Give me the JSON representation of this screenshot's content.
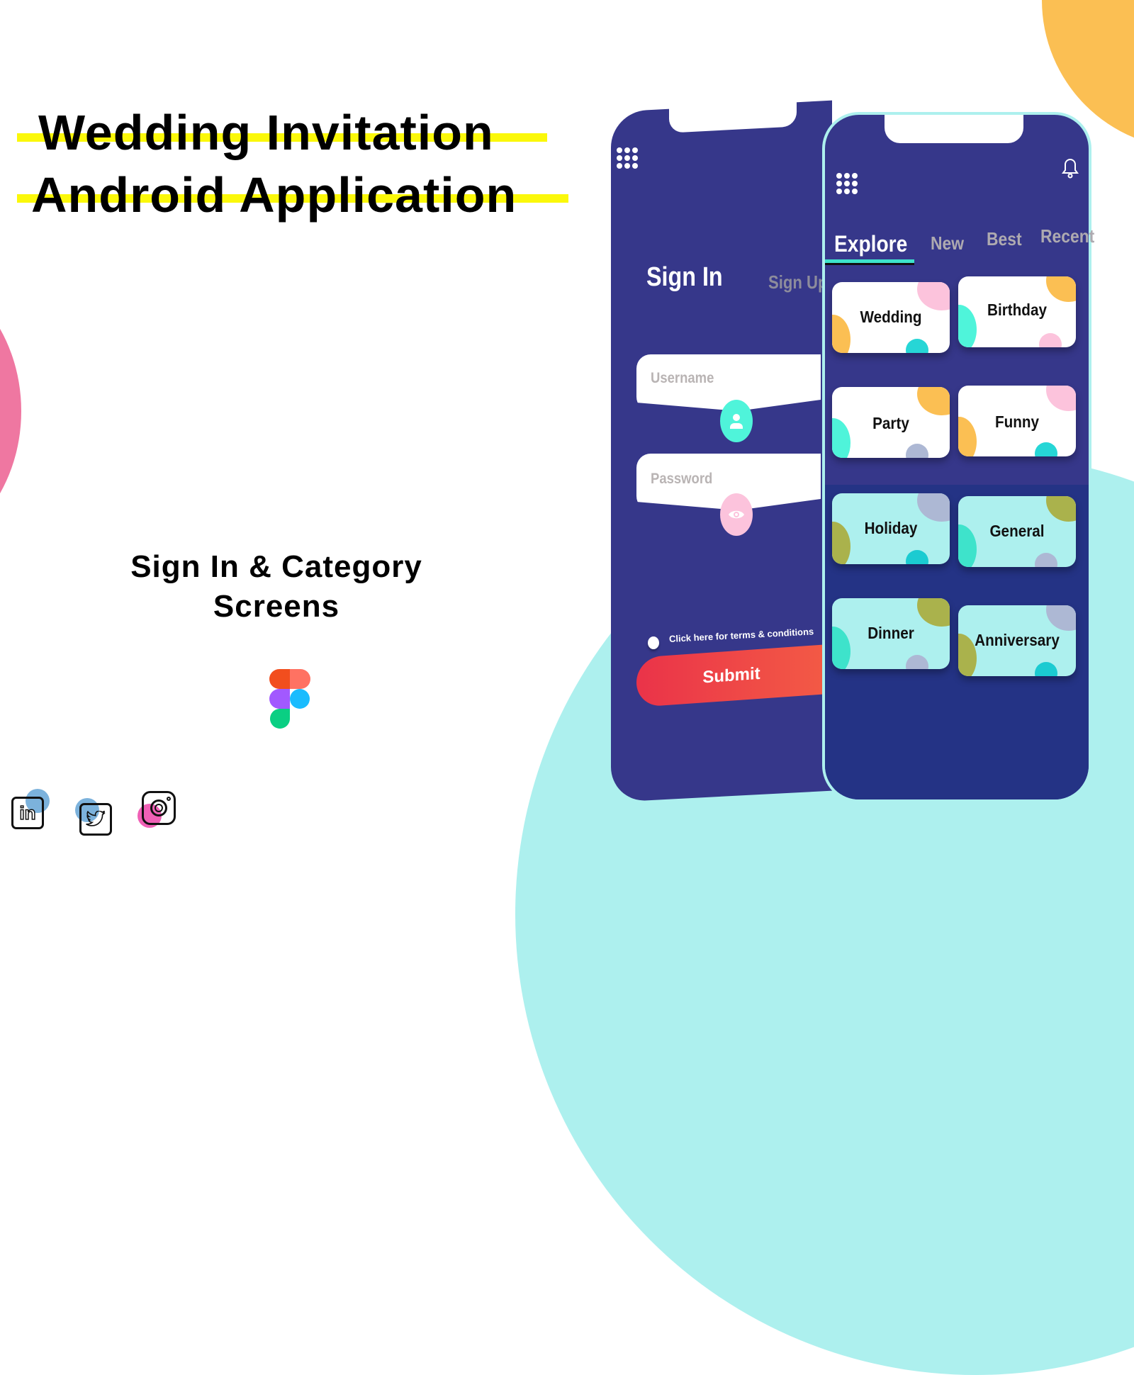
{
  "header": {
    "title_line1": "Wedding Invitation",
    "title_line2": "Android Application",
    "subtitle_line1": "Sign In & Category",
    "subtitle_line2": "Screens"
  },
  "colors": {
    "phone": "#36378a",
    "highlight": "#fbf80a",
    "accent_teal": "#3ee3cb",
    "submit_start": "#ea3349",
    "submit_end": "#f35a45",
    "bg_teal": "#adf0ee",
    "bg_orange": "#fbbf53",
    "bg_pink": "#ef77a1"
  },
  "signin_screen": {
    "menu_icon": "grid-dots-icon",
    "title": "Sign In",
    "alt_tab": "Sign Up",
    "username_placeholder": "Username",
    "username_icon": "user-icon",
    "password_placeholder": "Password",
    "password_icon": "eye-icon",
    "terms_text": "Click here for terms & conditions",
    "submit_label": "Submit"
  },
  "category_screen": {
    "menu_icon": "grid-dots-icon",
    "notification_icon": "bell-icon",
    "tabs": [
      {
        "label": "Explore",
        "active": true
      },
      {
        "label": "New",
        "active": false
      },
      {
        "label": "Best",
        "active": false
      },
      {
        "label": "Recent",
        "active": false
      }
    ],
    "categories": [
      {
        "label": "Wedding"
      },
      {
        "label": "Birthday"
      },
      {
        "label": "Party"
      },
      {
        "label": "Funny"
      },
      {
        "label": "Holiday"
      },
      {
        "label": "General"
      },
      {
        "label": "Dinner"
      },
      {
        "label": "Anniversary"
      }
    ]
  },
  "tools": {
    "design_tool_icon": "figma-logo-icon"
  },
  "social": [
    {
      "name": "linkedin-icon",
      "text": "in"
    },
    {
      "name": "twitter-icon"
    },
    {
      "name": "instagram-icon"
    }
  ]
}
